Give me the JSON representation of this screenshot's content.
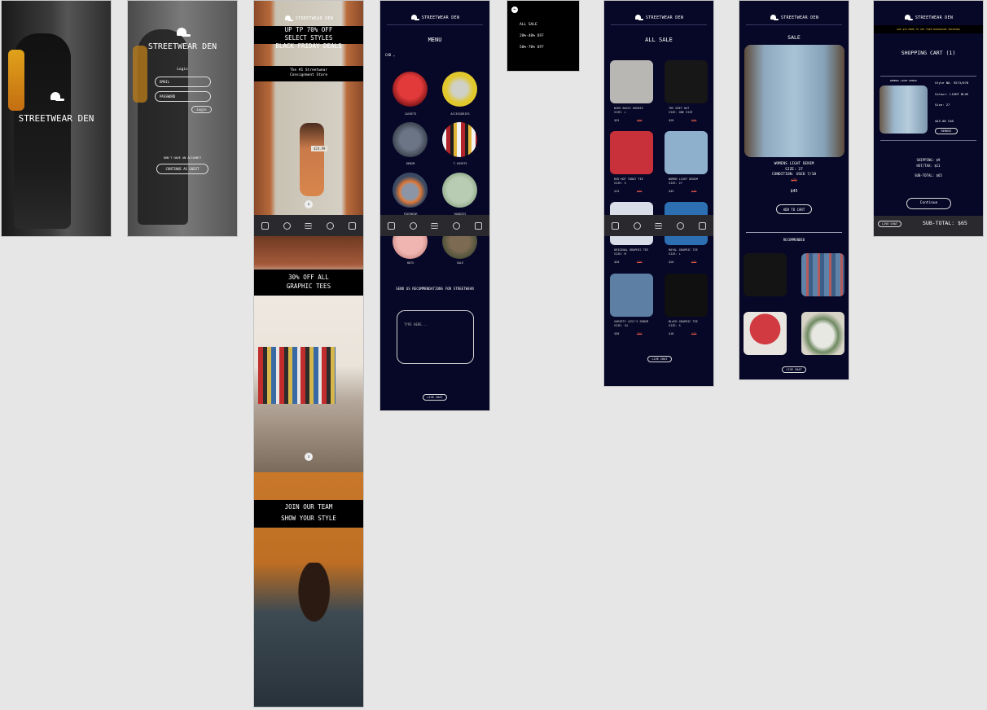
{
  "brand": {
    "name": "STREETWEAR DEN"
  },
  "splash": {
    "title": "STREETWEAR DEN"
  },
  "login": {
    "title": "STREETWEAR DEN",
    "heading": "Login",
    "email_placeholder": "EMAIL",
    "password_placeholder": "PASSWORD",
    "login_button": "Login",
    "no_account": "DON'T HAVE AN ACCOUNT?",
    "guest_button": "CONTINUE AS GUEST"
  },
  "home": {
    "banner1_line1": "UP TP 70% OFF",
    "banner1_line2": "SELECT STYLES",
    "banner1_line3": "BLACK FRIDAY DEALS",
    "tagline_line1": "The #1 Streetwear",
    "tagline_line2": "Consignment Store",
    "price_tag": "$24.99",
    "banner2_line1": "30% OFF ALL",
    "banner2_line2": "GRAPHIC TEES",
    "banner3_line1": "JOIN OUR TEAM",
    "banner3_line2": "SHOW YOUR STYLE"
  },
  "menu": {
    "title": "MENU",
    "currency": "CAD",
    "categories": [
      {
        "label": "JACKETS",
        "color": "#c9232b"
      },
      {
        "label": "ACCESSORIES",
        "color": "#d9c42a"
      },
      {
        "label": "DENIM",
        "color": "#4c5566"
      },
      {
        "label": "T-SHIRTS",
        "color": "#a8262a"
      },
      {
        "label": "FOOTWEAR",
        "color": "#3b4a63"
      },
      {
        "label": "HOODIES",
        "color": "#9fb49a"
      },
      {
        "label": "HATS",
        "color": "#d9a3a0"
      },
      {
        "label": "SALE",
        "color": "#4d5a3f"
      }
    ],
    "recommend_label": "SEND US RECOMMENDATIONS FOR STREETWEAR",
    "textarea_placeholder": "TYPE HERE...",
    "live_chat": "LIVE CHAT"
  },
  "dropdown": {
    "items": [
      "ALL SALE",
      "20%-40% OFF",
      "50%-70% OFF"
    ]
  },
  "all_sale": {
    "title": "ALL SALE",
    "products": [
      {
        "name": "NIKE BASIC HOODIE",
        "size": "SIZE: L",
        "price": "$25",
        "old": "$40",
        "color": "#b9b7b3"
      },
      {
        "name": "TRE GREY HAT",
        "size": "SIZE: ONE SIZE",
        "price": "$20",
        "old": "$35",
        "color": "#171717"
      },
      {
        "name": "RED HOT TODAY TEE",
        "size": "SIZE: S",
        "price": "$15",
        "old": "$25",
        "color": "#c8303a"
      },
      {
        "name": "WOMEN LIGHT DENIM",
        "size": "SIZE: 27",
        "price": "$45",
        "old": "$70",
        "color": "#8fb0cc"
      },
      {
        "name": "ORIGINAL GRAPHIC TEE",
        "size": "SIZE: M",
        "price": "$20",
        "old": "$30",
        "color": "#d8dde8"
      },
      {
        "name": "ROYAL GRAPHIC TEE",
        "size": "SIZE: L",
        "price": "$20",
        "old": "$35",
        "color": "#2d6fb3"
      },
      {
        "name": "VARIETY LEVI'S DENIM",
        "size": "SIZE: 34",
        "price": "$30",
        "old": "$50",
        "color": "#5c7fa3"
      },
      {
        "name": "BLACK GRAPHIC TEE",
        "size": "SIZE: S",
        "price": "$18",
        "old": "$30",
        "color": "#101010"
      }
    ],
    "live_chat": "LIVE CHAT"
  },
  "product": {
    "title": "SALE",
    "name": "WOMENS LIGHT DENIM",
    "size": "SIZE: 27",
    "condition": "CONDITION: USED 7/10",
    "old_price": "$70",
    "price": "$45",
    "add_to_cart": "ADD TO CART",
    "recommended": "RECOMMENDED",
    "live_chat": "LIVE CHAT"
  },
  "cart": {
    "promo": "ADD $35 MORE TO GET FREE WORLDWIDE SHIPPING",
    "title": "SHOPPING CART (1)",
    "item_name": "WOMENS LIGHT DENIM",
    "style": "Style NO. 9273/678",
    "colour": "Colour: LIGHT BLUE",
    "size": "Size: 27",
    "item_price": "$45.00 CAD",
    "remove": "REMOVE",
    "shipping": "SHIPPING: $9",
    "tax": "HST/TAX: $11",
    "subtotal": "SUB-TOTAL: $65",
    "continue": "Continue",
    "live_chat": "LIVE CHAT",
    "footer_subtotal": "SUB-TOTAL: $65"
  }
}
